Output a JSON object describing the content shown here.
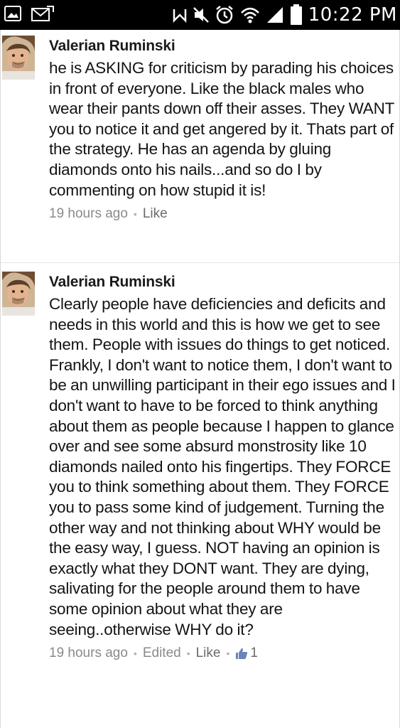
{
  "status_bar": {
    "time": "10:22 PM",
    "icons": [
      "gallery-icon",
      "mail-icon",
      "nfc-icon",
      "mute-icon",
      "alarm-icon",
      "wifi-icon",
      "signal-icon",
      "battery-icon"
    ]
  },
  "comments": [
    {
      "author": "Valerian Ruminski",
      "text": "he is ASKING for criticism by parading his choices in front of everyone. Like the black males who wear their pants down off their asses. They WANT you to notice it and get angered by it. Thats part of the strategy. He has an agenda by gluing diamonds onto his nails...and so do I by commenting on how stupid it is!",
      "time": "19 hours ago",
      "like_label": "Like"
    },
    {
      "author": "Valerian Ruminski",
      "text": "Clearly people have deficiencies and deficits and needs in this world and this is how we get to see them. People with issues do things to get noticed. Frankly, I don't want to notice them, I don't want to be an unwilling participant in their ego issues and I don't want to have to be forced to think anything about them as people because I happen to glance over and see some absurd monstrosity like 10 diamonds nailed onto his fingertips. They FORCE you to think something about them. They FORCE you to pass some kind of judgement. Turning the other way and not thinking about WHY would be the easy way, I guess. NOT having an opinion is exactly what they DONT want. They are dying, salivating for the people around them to have some opinion about what they are seeing..otherwise WHY do it?",
      "time": "19 hours ago",
      "edited_label": "Edited",
      "like_label": "Like",
      "like_count": "1"
    }
  ],
  "colors": {
    "status_bar_bg": "#000000",
    "text": "#141414",
    "meta": "#8a8a8a"
  }
}
